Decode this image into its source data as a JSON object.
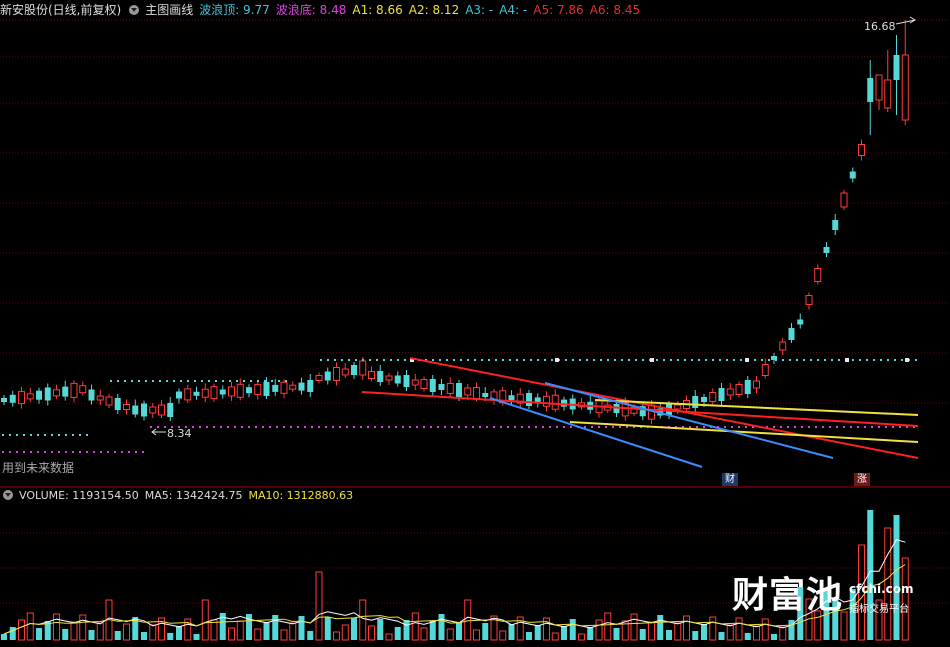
{
  "header": {
    "stock": "新安股份(日线,前复权)",
    "indicator": "主图画线",
    "items": [
      {
        "label": "波浪顶: 9.77",
        "color": "#3fc6d8"
      },
      {
        "label": "波浪底: 8.48",
        "color": "#e040e0"
      },
      {
        "label": "A1: 8.66",
        "color": "#f0e040"
      },
      {
        "label": "A2: 8.12",
        "color": "#f0e040"
      },
      {
        "label": "A3: -",
        "color": "#3fc6d8"
      },
      {
        "label": "A4: -",
        "color": "#3fc6d8"
      },
      {
        "label": "A5: 7.86",
        "color": "#e03030"
      },
      {
        "label": "A6: 8.45",
        "color": "#e03030"
      }
    ]
  },
  "annotations": {
    "high": "16.68",
    "low": "8.34",
    "future_data": "用到未来数据",
    "tag_cai": "财",
    "tag_zhang": "涨"
  },
  "volume_header": {
    "volume": "VOLUME: 1193154.50",
    "ma5": "MA5: 1342424.75",
    "ma10": "MA10: 1312880.63"
  },
  "watermark": {
    "brand": "财富池",
    "domain": "cfchi.com",
    "slogan": "指标交易平台"
  },
  "colors": {
    "up": "#ff3b3b",
    "down": "#54d8d8",
    "ma5": "#ffffff",
    "ma10": "#f0e040",
    "grid": "#7a0000"
  }
}
